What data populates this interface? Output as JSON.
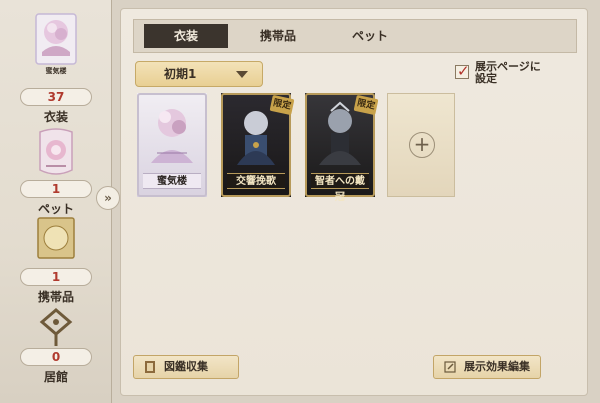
{
  "sidebar": {
    "costume": {
      "count": "37",
      "label": "衣装",
      "icon_text": "蜜気楼"
    },
    "pet": {
      "count": "1",
      "label": "ペット"
    },
    "item": {
      "count": "1",
      "label": "携帯品"
    },
    "residence": {
      "count": "0",
      "label": "居館"
    }
  },
  "tabs": [
    "衣装",
    "携帯品",
    "ペット"
  ],
  "dropdown": {
    "value": "初期1"
  },
  "showcase": {
    "label_line1": "展示ページに",
    "label_line2": "設定",
    "checked": true
  },
  "cards": [
    {
      "name": "蜜気楼",
      "limited": ""
    },
    {
      "name": "交響挽歌",
      "limited": "限定"
    },
    {
      "name": "智者への戴冠",
      "limited": "限定"
    }
  ],
  "buttons": {
    "encyclopedia": "図鑑収集",
    "display_edit": "展示効果編集"
  },
  "colors": {
    "accent_red": "#b03a2e",
    "gold": "#c8a24a",
    "tab_active": "#3b342d"
  }
}
